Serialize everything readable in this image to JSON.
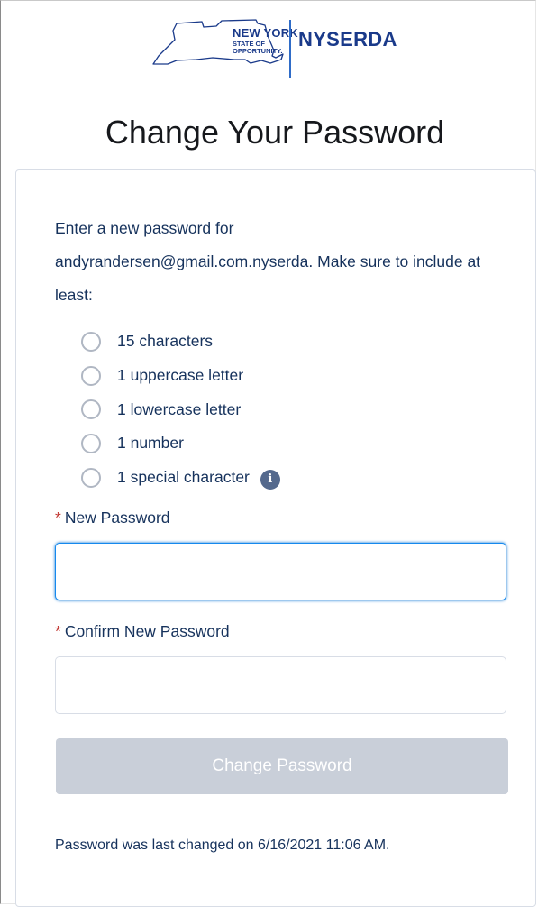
{
  "header": {
    "logo_main": "NEW YORK",
    "logo_sub_1": "STATE OF",
    "logo_sub_2": "OPPORTUNITY.",
    "org_name": "NYSERDA"
  },
  "page": {
    "title": "Change Your Password"
  },
  "instructions": {
    "prefix": "Enter a new password for",
    "username": "andyrandersen@gmail.com.nyserda",
    "suffix": ". Make sure to include at least:"
  },
  "requirements": [
    {
      "label": "15 characters"
    },
    {
      "label": "1 uppercase letter"
    },
    {
      "label": "1 lowercase letter"
    },
    {
      "label": "1 number"
    },
    {
      "label": "1 special character"
    }
  ],
  "form": {
    "required_marker": "*",
    "new_password_label": "New Password",
    "new_password_value": "",
    "confirm_password_label": "Confirm New Password",
    "confirm_password_value": "",
    "submit_label": "Change Password",
    "submit_disabled": true
  },
  "footer": {
    "last_changed": "Password was last changed on 6/16/2021 11:06 AM."
  },
  "colors": {
    "brand_blue": "#1a3a8a",
    "text": "#16325c",
    "required": "#c23934",
    "focus": "#1589ee",
    "button_disabled": "#c9cfd9",
    "info_icon": "#54698d"
  }
}
